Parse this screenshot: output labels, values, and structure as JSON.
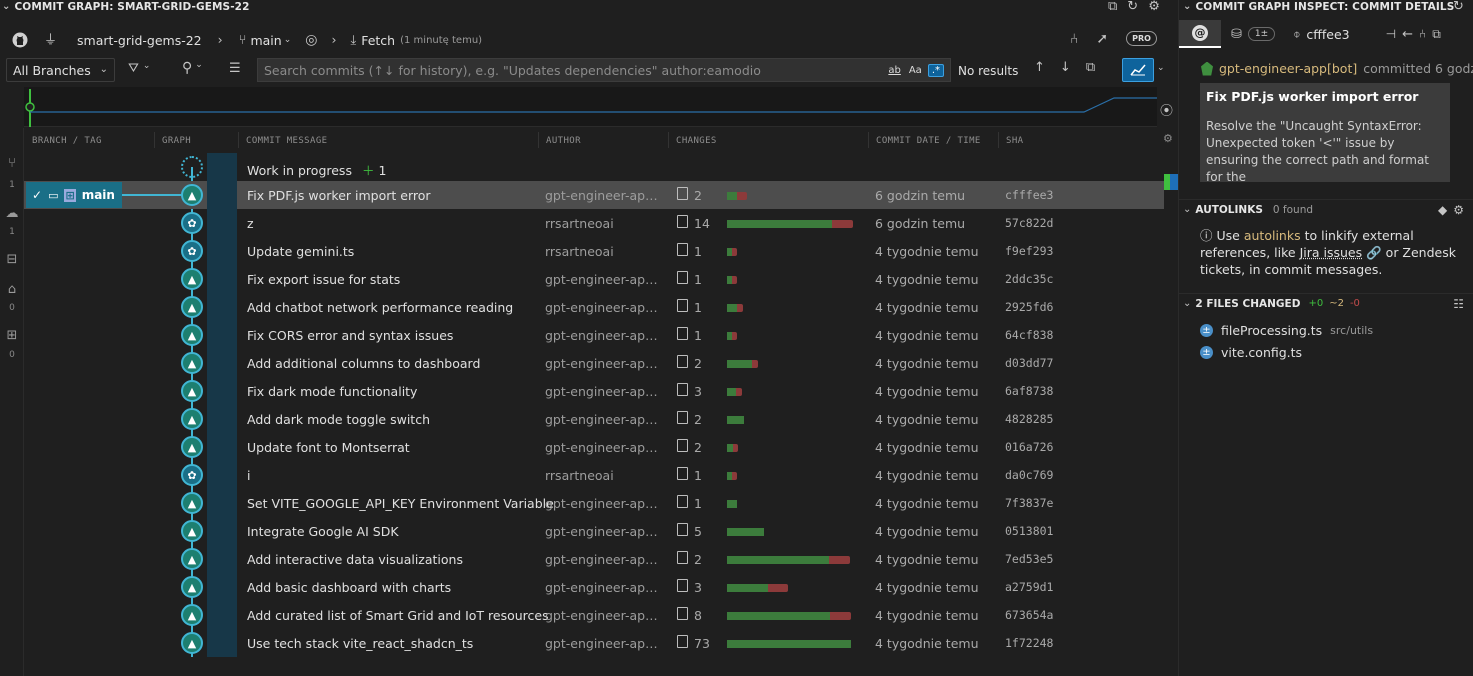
{
  "graph_panel": {
    "title": "COMMIT GRAPH: SMART-GRID-GEMS-22",
    "repo": "smart-grid-gems-22",
    "branch": "main",
    "fetch_label": "Fetch",
    "fetch_time": "(1 minutę temu)",
    "pro_badge": "PRO",
    "branches_select": "All Branches",
    "search_placeholder": "Search commits (↑↓ for history), e.g. \"Updates dependencies\" author:eamodio",
    "search_results": "No results",
    "match_case": "Aa",
    "match_word": "ab",
    "regex": ".*",
    "columns": {
      "branch_tag": "BRANCH / TAG",
      "graph": "GRAPH",
      "message": "COMMIT MESSAGE",
      "author": "AUTHOR",
      "changes": "CHANGES",
      "date": "COMMIT DATE / TIME",
      "sha": "SHA"
    },
    "branch_ref": "main",
    "sidebar_counts": [
      "1",
      "1",
      "0",
      "0"
    ],
    "wip": {
      "label": "Work in progress",
      "count": "1"
    },
    "commits": [
      {
        "message": "Fix PDF.js worker import error",
        "author": "gpt-engineer-app[bot]",
        "files": "2",
        "added": 0.08,
        "removed": 0.08,
        "date": "6 godzin temu",
        "sha": "cfffee3",
        "bot": true
      },
      {
        "message": "z",
        "author": "rrsartneoai",
        "files": "14",
        "added": 0.85,
        "removed": 0.17,
        "date": "6 godzin temu",
        "sha": "57c822d",
        "bot": false
      },
      {
        "message": "Update gemini.ts",
        "author": "rrsartneoai",
        "files": "1",
        "added": 0.04,
        "removed": 0.04,
        "date": "4 tygodnie temu",
        "sha": "f9ef293",
        "bot": false
      },
      {
        "message": "Fix export issue for stats",
        "author": "gpt-engineer-app[bot]",
        "files": "1",
        "added": 0.04,
        "removed": 0.04,
        "date": "4 tygodnie temu",
        "sha": "2ddc35c",
        "bot": true
      },
      {
        "message": "Add chatbot network performance reading",
        "author": "gpt-engineer-app[bot]",
        "files": "1",
        "added": 0.08,
        "removed": 0.05,
        "date": "4 tygodnie temu",
        "sha": "2925fd6",
        "bot": true
      },
      {
        "message": "Fix CORS error and syntax issues",
        "author": "gpt-engineer-app[bot]",
        "files": "1",
        "added": 0.04,
        "removed": 0.04,
        "date": "4 tygodnie temu",
        "sha": "64cf838",
        "bot": true
      },
      {
        "message": "Add additional columns to dashboard",
        "author": "gpt-engineer-app[bot]",
        "files": "2",
        "added": 0.2,
        "removed": 0.05,
        "date": "4 tygodnie temu",
        "sha": "d03dd77",
        "bot": true
      },
      {
        "message": "Fix dark mode functionality",
        "author": "gpt-engineer-app[bot]",
        "files": "3",
        "added": 0.07,
        "removed": 0.05,
        "date": "4 tygodnie temu",
        "sha": "6af8738",
        "bot": true
      },
      {
        "message": "Add dark mode toggle switch",
        "author": "gpt-engineer-app[bot]",
        "files": "2",
        "added": 0.14,
        "removed": 0.0,
        "date": "4 tygodnie temu",
        "sha": "4828285",
        "bot": true
      },
      {
        "message": "Update font to Montserrat",
        "author": "gpt-engineer-app[bot]",
        "files": "2",
        "added": 0.05,
        "removed": 0.04,
        "date": "4 tygodnie temu",
        "sha": "016a726",
        "bot": true
      },
      {
        "message": "i",
        "author": "rrsartneoai",
        "files": "1",
        "added": 0.04,
        "removed": 0.04,
        "date": "4 tygodnie temu",
        "sha": "da0c769",
        "bot": false
      },
      {
        "message": "Set VITE_GOOGLE_API_KEY Environment Variable",
        "author": "gpt-engineer-app[bot]",
        "files": "1",
        "added": 0.08,
        "removed": 0.0,
        "date": "4 tygodnie temu",
        "sha": "7f3837e",
        "bot": true
      },
      {
        "message": "Integrate Google AI SDK",
        "author": "gpt-engineer-app[bot]",
        "files": "5",
        "added": 0.3,
        "removed": 0.0,
        "date": "4 tygodnie temu",
        "sha": "0513801",
        "bot": true
      },
      {
        "message": "Add interactive data visualizations",
        "author": "gpt-engineer-app[bot]",
        "files": "2",
        "added": 0.82,
        "removed": 0.17,
        "date": "4 tygodnie temu",
        "sha": "7ed53e5",
        "bot": true
      },
      {
        "message": "Add basic dashboard with charts",
        "author": "gpt-engineer-app[bot]",
        "files": "3",
        "added": 0.33,
        "removed": 0.16,
        "date": "4 tygodnie temu",
        "sha": "a2759d1",
        "bot": true
      },
      {
        "message": "Add curated list of Smart Grid and IoT resources",
        "author": "gpt-engineer-app[bot]",
        "files": "8",
        "added": 0.83,
        "removed": 0.17,
        "date": "4 tygodnie temu",
        "sha": "673654a",
        "bot": true
      },
      {
        "message": "Use tech stack vite_react_shadcn_ts",
        "author": "gpt-engineer-app[bot]",
        "files": "73",
        "added": 1.0,
        "removed": 0.0,
        "date": "4 tygodnie temu",
        "sha": "1f72248",
        "bot": true
      }
    ]
  },
  "inspect_panel": {
    "title": "COMMIT GRAPH INSPECT: COMMIT DETAILS",
    "changes_badge": "1±",
    "sha": "cfffee3",
    "author": "gpt-engineer-app[bot]",
    "committed_text": "committed 6 godz",
    "commit_title": "Fix PDF.js worker import error",
    "commit_body": "Resolve the \"Uncaught SyntaxError: Unexpected token '<'\" issue by ensuring the correct path and format for the",
    "autolinks": {
      "title": "AUTOLINKS",
      "found": "0 found",
      "text_use": "Use",
      "link_autolinks": "autolinks",
      "text_mid": "to linkify external references, like",
      "link_jira": "Jira issues",
      "text_end": "or Zendesk tickets, in commit messages."
    },
    "files_changed": {
      "title": "2 FILES CHANGED",
      "added": "+0",
      "modified": "~2",
      "removed": "-0",
      "files": [
        {
          "name": "fileProcessing.ts",
          "path": "src/utils"
        },
        {
          "name": "vite.config.ts",
          "path": ""
        }
      ]
    }
  },
  "colors": {
    "accent": "#41b6d4",
    "selected_row": "#4d4d4d",
    "added": "#3c7c3c",
    "removed": "#8c3a3a",
    "link": "#d7ba7d"
  }
}
